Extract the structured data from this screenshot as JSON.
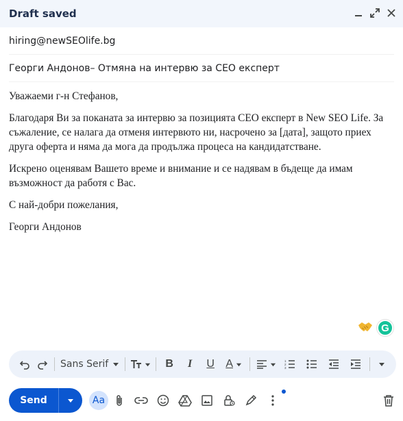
{
  "window": {
    "title": "Draft saved"
  },
  "compose": {
    "to": "hiring@newSEOlife.bg",
    "subject": "Георги Андонов– Отмяна на интервю за СЕО експерт",
    "body": {
      "greeting": "Уважаеми г-н Стефанов,",
      "paragraph1": "Благодаря Ви за поканата за интервю за позицията СЕО експерт в New SEO Life. За съжаление, се налага да отменя интервюто ни, насрочено за [дата], защото приех друга оферта и няма да мога да продължа процеса на кандидатстване.",
      "paragraph2": "Искрено оценявам Вашето време и внимание и се надявам в бъдеще да имам възможност да работя с Вас.",
      "closing": "С най-добри пожелания,",
      "signature": "Георги Андонов"
    }
  },
  "grammarly": {
    "badge_letter": "G"
  },
  "formatting": {
    "font": "Sans Serif",
    "bold_label": "B",
    "italic_label": "I",
    "underline_label": "U",
    "text_color_label": "A"
  },
  "actions": {
    "send_label": "Send",
    "format_toggle_label": "Aa"
  },
  "colors": {
    "send_blue": "#0b57d0",
    "titlebar_bg": "#f2f6fc",
    "toolbar_bg": "#edf2fa",
    "grammarly_green": "#15c39a"
  }
}
